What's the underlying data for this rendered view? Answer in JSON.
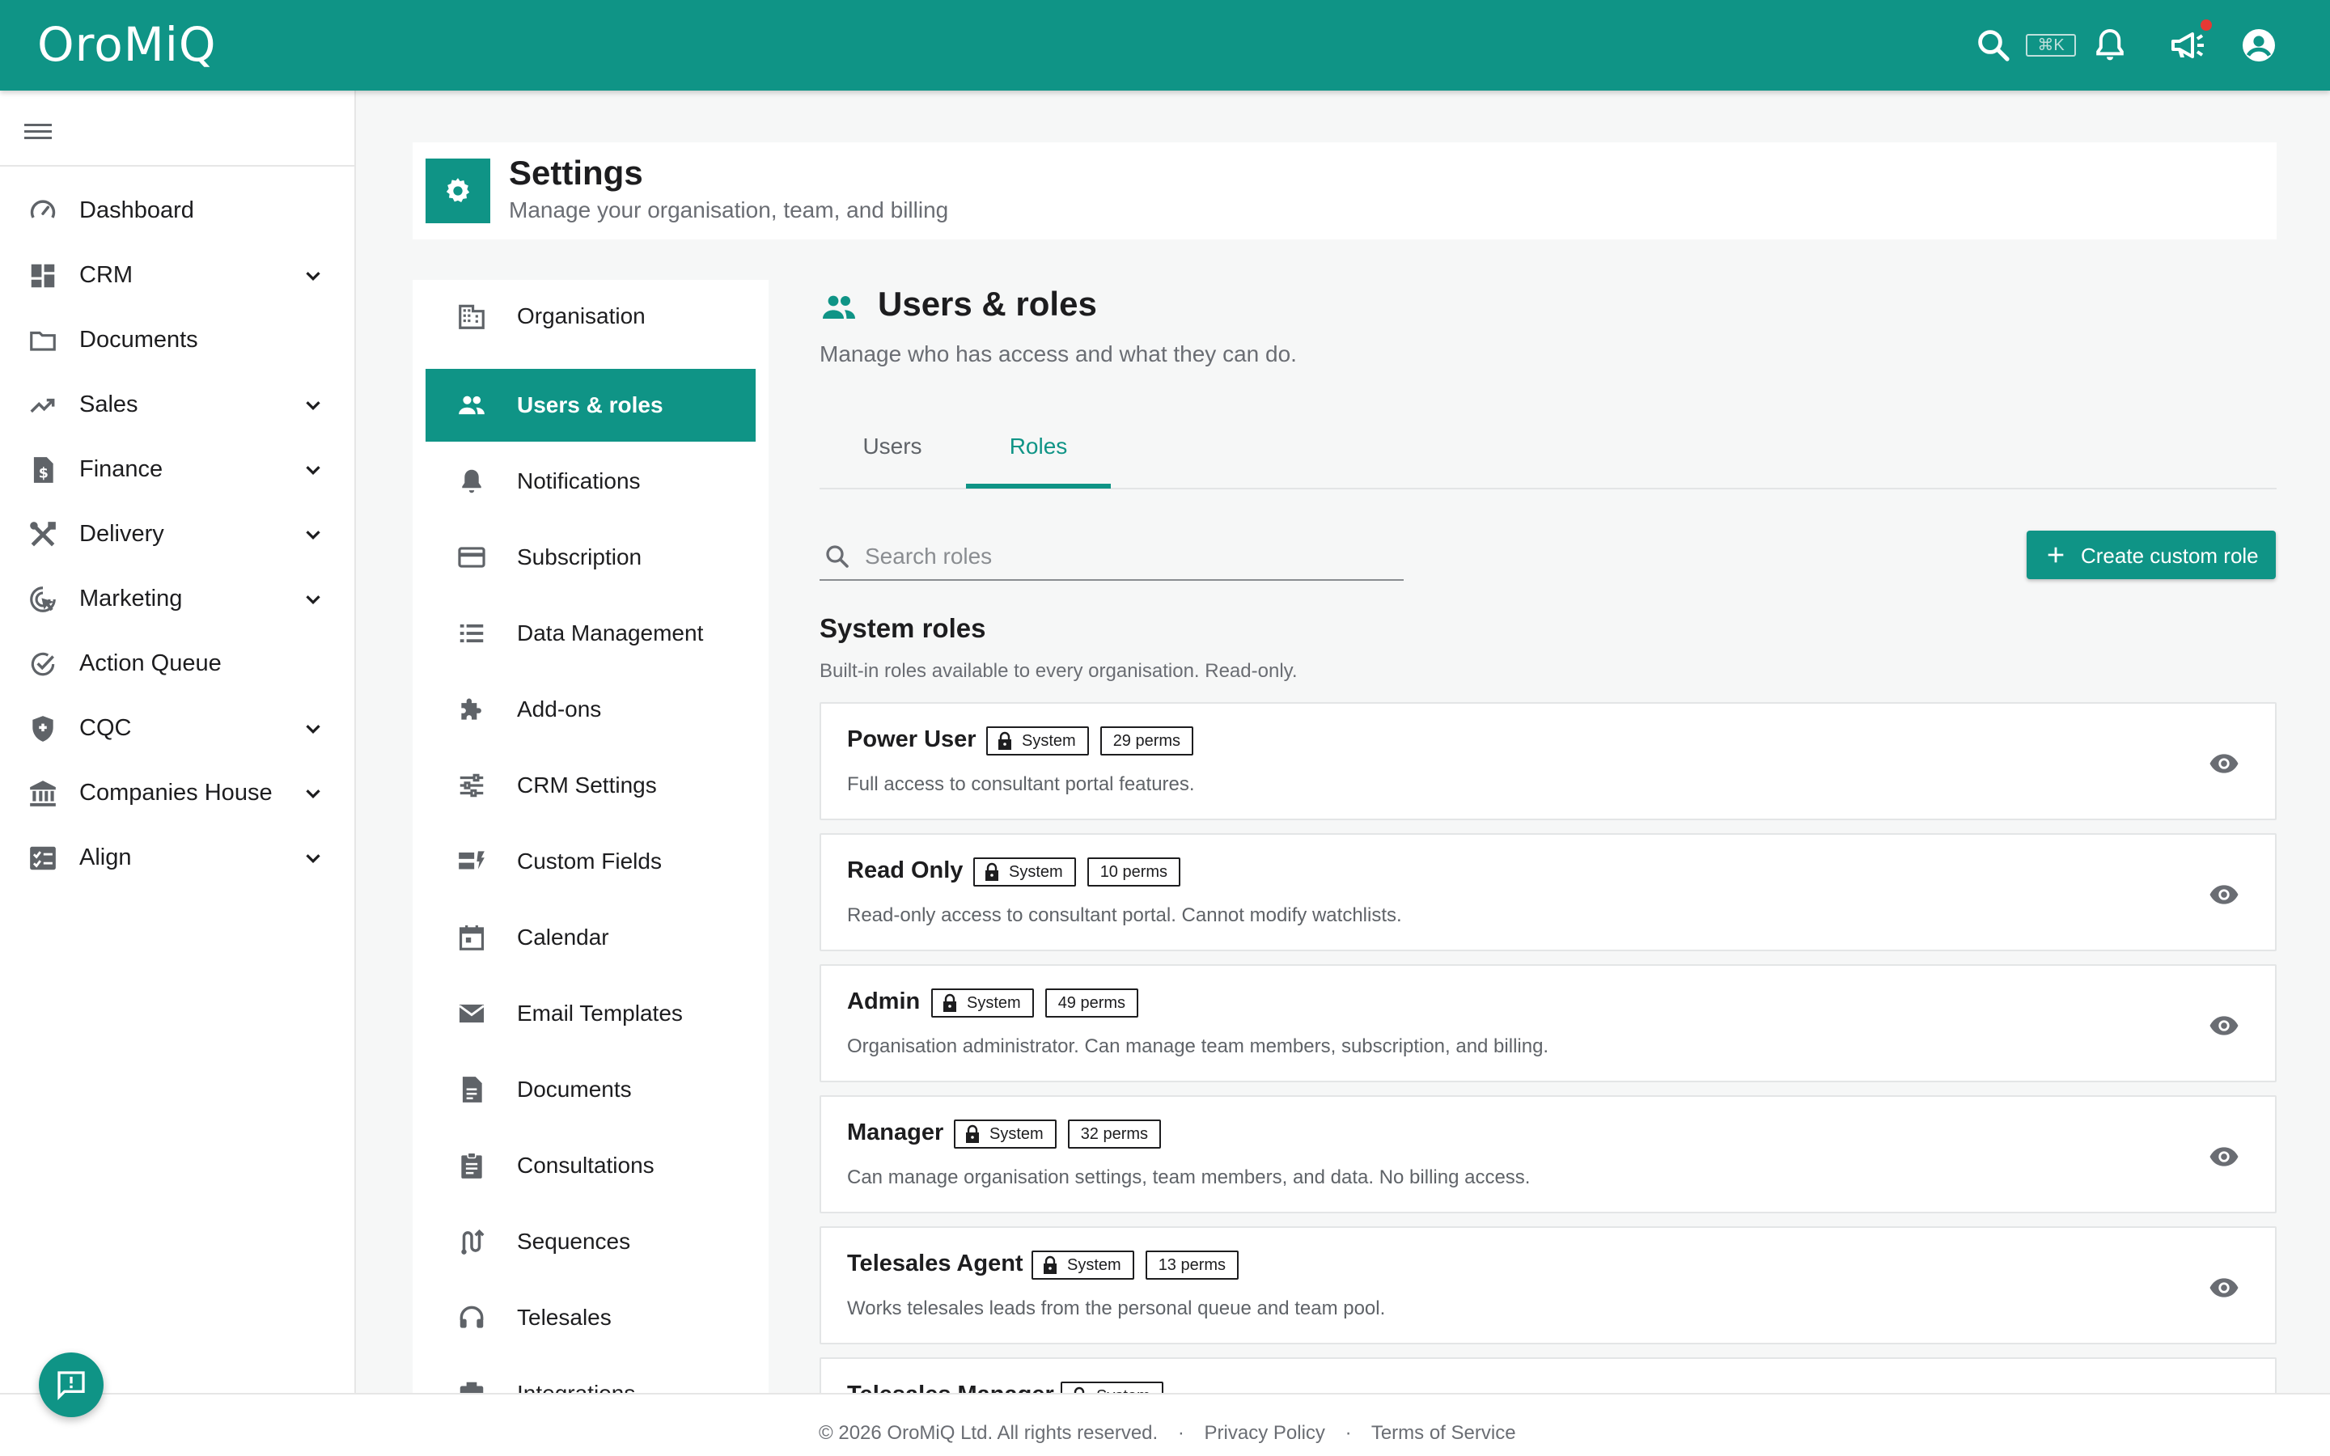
{
  "app": {
    "name": "OroMiQ"
  },
  "topbar": {
    "shortcut": "⌘K"
  },
  "leftnav": {
    "items": [
      {
        "label": "Dashboard",
        "icon": "speedometer-icon"
      },
      {
        "label": "CRM",
        "icon": "dashboard-grid-icon"
      },
      {
        "label": "Documents",
        "icon": "folder-icon"
      },
      {
        "label": "Sales",
        "icon": "trending-up-icon"
      },
      {
        "label": "Finance",
        "icon": "invoice-icon"
      },
      {
        "label": "Delivery",
        "icon": "tools-icon"
      },
      {
        "label": "Marketing",
        "icon": "cursor-target-icon"
      },
      {
        "label": "Action Queue",
        "icon": "check-circle-icon"
      },
      {
        "label": "CQC",
        "icon": "shield-icon"
      },
      {
        "label": "Companies House",
        "icon": "bank-icon"
      },
      {
        "label": "Align",
        "icon": "checklist-icon"
      }
    ]
  },
  "header": {
    "title": "Settings",
    "subtitle": "Manage your organisation, team, and billing"
  },
  "settings_menu": {
    "items": [
      {
        "label": "Organisation",
        "icon": "building-icon"
      },
      {
        "label": "Users & roles",
        "icon": "people-icon",
        "active": true
      },
      {
        "label": "Notifications",
        "icon": "bell-icon"
      },
      {
        "label": "Subscription",
        "icon": "credit-card-icon"
      },
      {
        "label": "Data Management",
        "icon": "list-icon"
      },
      {
        "label": "Add-ons",
        "icon": "puzzle-icon"
      },
      {
        "label": "CRM Settings",
        "icon": "sliders-icon"
      },
      {
        "label": "Custom Fields",
        "icon": "dynamic-form-icon"
      },
      {
        "label": "Calendar",
        "icon": "calendar-icon"
      },
      {
        "label": "Email Templates",
        "icon": "envelope-icon"
      },
      {
        "label": "Documents",
        "icon": "document-icon"
      },
      {
        "label": "Consultations",
        "icon": "clipboard-icon"
      },
      {
        "label": "Sequences",
        "icon": "route-icon"
      },
      {
        "label": "Telesales",
        "icon": "headset-icon"
      },
      {
        "label": "Integrations",
        "icon": "integration-icon"
      }
    ]
  },
  "main": {
    "title": "Users & roles",
    "description": "Manage who has access and what they can do.",
    "tabs": [
      {
        "label": "Users",
        "active": false
      },
      {
        "label": "Roles",
        "active": true
      }
    ],
    "search": {
      "placeholder": "Search roles",
      "value": ""
    },
    "create_button": "Create custom role",
    "system_roles": {
      "title": "System roles",
      "description": "Built-in roles available to every organisation. Read-only.",
      "roles": [
        {
          "name": "Power User",
          "badge": "System",
          "perms": "29 perms",
          "description": "Full access to consultant portal features."
        },
        {
          "name": "Read Only",
          "badge": "System",
          "perms": "10 perms",
          "description": "Read-only access to consultant portal. Cannot modify watchlists."
        },
        {
          "name": "Admin",
          "badge": "System",
          "perms": "49 perms",
          "description": "Organisation administrator. Can manage team members, subscription, and billing."
        },
        {
          "name": "Manager",
          "badge": "System",
          "perms": "32 perms",
          "description": "Can manage organisation settings, team members, and data. No billing access."
        },
        {
          "name": "Telesales Agent",
          "badge": "System",
          "perms": "13 perms",
          "description": "Works telesales leads from the personal queue and team pool."
        },
        {
          "name": "Telesales Manager",
          "badge": "System",
          "perms": "",
          "description": ""
        }
      ]
    }
  },
  "footer": {
    "copyright": "© 2026 OroMiQ Ltd. All rights reserved.",
    "privacy": "Privacy Policy",
    "terms": "Terms of Service",
    "separator": "·"
  },
  "colors": {
    "brand": "#0f9486",
    "text": "#1d1d1f",
    "muted": "#6a6d73"
  }
}
